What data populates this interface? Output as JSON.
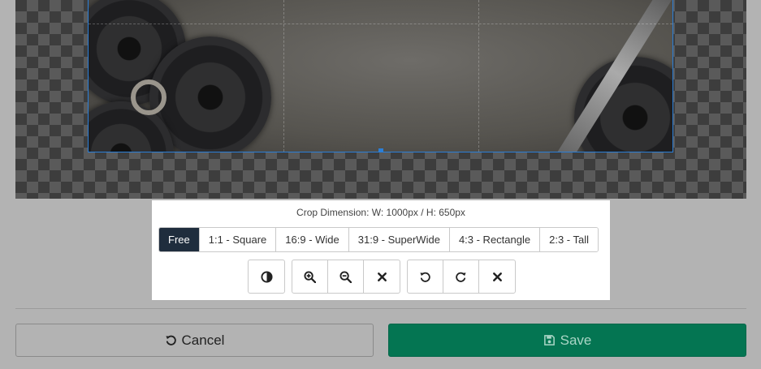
{
  "crop": {
    "dimension_label": "Crop Dimension: W: 1000px / H: 650px"
  },
  "ratios": [
    {
      "label": "Free",
      "active": true
    },
    {
      "label": "1:1 - Square",
      "active": false
    },
    {
      "label": "16:9 - Wide",
      "active": false
    },
    {
      "label": "31:9 - SuperWide",
      "active": false
    },
    {
      "label": "4:3 - Rectangle",
      "active": false
    },
    {
      "label": "2:3 - Tall",
      "active": false
    }
  ],
  "tools": {
    "contrast": "contrast-icon",
    "zoom_in": "zoom-in-icon",
    "zoom_out": "zoom-out-icon",
    "reset_zoom": "close-icon",
    "rotate_left": "rotate-left-icon",
    "rotate_right": "rotate-right-icon",
    "reset_rotate": "close-icon"
  },
  "actions": {
    "cancel_label": "Cancel",
    "save_label": "Save"
  },
  "colors": {
    "accent": "#047552",
    "active_ratio": "#1f2d3d",
    "crop_border": "#2b7fd8"
  }
}
